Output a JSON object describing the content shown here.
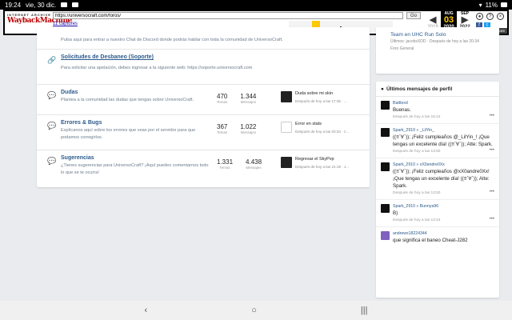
{
  "statusbar": {
    "time": "19:24",
    "date": "vie, 30 dic.",
    "battery": "11%"
  },
  "wayback": {
    "logo_top": "INTERNET ARCHIVE",
    "logo": "WaybackMachine",
    "url": "https://universocraft.com/foros/",
    "go": "Go",
    "captures": "11 captures",
    "range": "3 Aug 2020 - 7 Nov 2022",
    "prev_month": "",
    "cur_month": "AUG",
    "cur_day": "03",
    "cur_year": "2020",
    "prev_year": "2019",
    "next_month": "SEP",
    "next_year": "2022",
    "about": "About this capture"
  },
  "nodes": [
    {
      "title": "",
      "desc": "Pulsa aquí para entrar a nuestro Chat de Discord donde podrás hablar con toda la comunidad de UniversoCraft."
    },
    {
      "title": "Solicitudes de Desbaneo (Soporte)",
      "desc": "Para solicitar una apelación, debes ingresar a la siguiente web: https://soporte.universocraft.com"
    },
    {
      "title": "Dudas",
      "desc": "Plantea a la comunidad las dudas que tengas sobre UniversoCraft.",
      "temas": "470",
      "mensajes": "1.344",
      "latest_title": "Duda sobre mi skin",
      "latest_meta": "Después de hoy a las 17:36 · ..."
    },
    {
      "title": "Errores & Bugs",
      "desc": "Explícanos aquí sobre los errores que veas por el servidor para que podamos corregirlos.",
      "temas": "367",
      "mensajes": "1.022",
      "latest_title": "Error en stats",
      "latest_meta": "Después de hoy a las 03:34 · z..."
    },
    {
      "title": "Sugerencias",
      "desc": "¿Tienes sugerencias para UniversoCraft? ¡Aquí puedes comentarnos todo lo que se te ocurra!",
      "temas": "1.331",
      "mensajes": "4.438",
      "latest_title": "Regresar el SkyPvp",
      "latest_meta": "Después de hoy a las 21:19 · J..."
    }
  ],
  "labels": {
    "temas": "Temas",
    "mensajes": "Mensajes"
  },
  "sidebar_thread": {
    "title": "Team en UHC Run Solo",
    "meta": "Últimos: jacobxXDD · Después de hoy a las 20:34",
    "forum": "Foro General"
  },
  "profile_posts": {
    "heading": "Últimos mensajes de perfil",
    "items": [
      {
        "who": "Battlexd",
        "msg": "Buenas.",
        "when": "Después de hoy a las 16:12"
      },
      {
        "who": "Spark_2910 » _LilYin_",
        "msg": "((≡ˊ∀ˋ)); ¡Feliz cumpleaños @_LilYin_! ¡Que tengas un excelente día! ((≡ˊ∀ˋ)); Atte: Spark.",
        "when": "Después de hoy a las 13:50"
      },
      {
        "who": "Spark_2910 » xX0andre0Xx",
        "msg": "((≡ˊ∀ˋ)); ¡Feliz cumpleaños @xX0andre0Xx! ¡Que tengas un excelente día! ((≡ˊ∀ˋ)); Atte: Spark.",
        "when": "Después de hoy a las 13:50"
      },
      {
        "who": "Spark_2910 » Bunnya96",
        "msg": "B)",
        "when": "Después de hoy a las 13:44"
      },
      {
        "who": "andrews18224344",
        "msg": "que significa el baneo Cheat-J282",
        "when": ""
      }
    ]
  }
}
